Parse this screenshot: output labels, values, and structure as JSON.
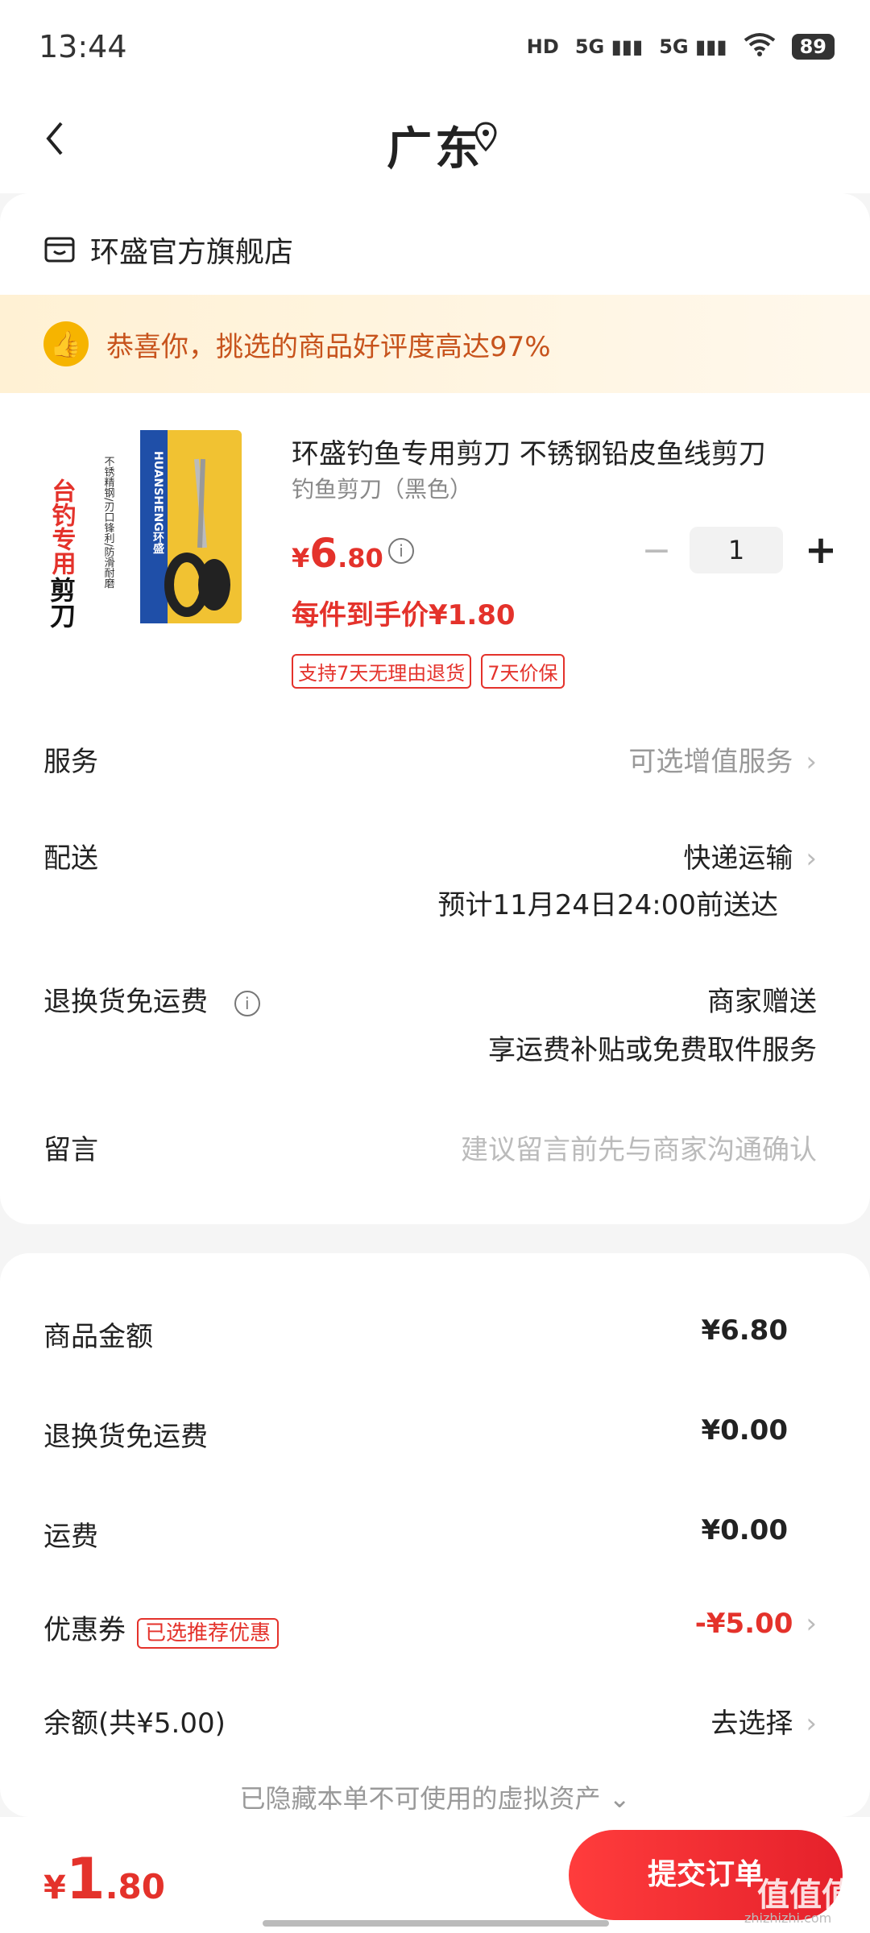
{
  "status": {
    "time": "13:44",
    "hd": "HD",
    "net1": "5G",
    "net2": "5G",
    "battery": "89"
  },
  "nav": {
    "title": "广东"
  },
  "store": {
    "name": "环盛官方旗舰店"
  },
  "banner": {
    "text": "恭喜你，挑选的商品好评度高达97%"
  },
  "product": {
    "title": "环盛钓鱼专用剪刀 不锈钢铅皮鱼线剪刀",
    "spec": "钓鱼剪刀（黑色）",
    "price_symbol": "¥",
    "price_int": "6",
    "price_dec": ".80",
    "each_price": "每件到手价¥1.80",
    "tags": [
      "支持7天无理由退货",
      "7天价保"
    ],
    "qty": "1",
    "image_text_red": "台钓专用",
    "image_text_black": "剪刀",
    "image_text_side": "不锈精钢/刃口锋利/防滑耐磨",
    "image_brand": "HUANSHENG环盛"
  },
  "rows": {
    "service_label": "服务",
    "service_value": "可选增值服务",
    "delivery_label": "配送",
    "delivery_value": "快递运输",
    "delivery_eta": "预计11月24日24:00前送达",
    "return_label": "退换货免运费",
    "return_value": "商家赠送",
    "return_note": "享运费补贴或免费取件服务",
    "message_label": "留言",
    "message_placeholder": "建议留言前先与商家沟通确认"
  },
  "summary": {
    "goods_label": "商品金额",
    "goods_value": "¥6.80",
    "return_label": "退换货免运费",
    "return_value": "¥0.00",
    "ship_label": "运费",
    "ship_value": "¥0.00",
    "coupon_label": "优惠券",
    "coupon_tag": "已选推荐优惠",
    "coupon_value": "-¥5.00",
    "balance_label": "余额(共¥5.00)",
    "balance_value": "去选择",
    "hidden_note": "已隐藏本单不可使用的虚拟资产"
  },
  "footer": {
    "total_symbol": "¥",
    "total_int": "1",
    "total_dec": ".80",
    "submit_label": "提交订单",
    "watermark": "值值值",
    "watermark_sub": "zhizhizhi.com"
  },
  "colors": {
    "accent": "#e4322b",
    "banner_text": "#c7531c"
  }
}
